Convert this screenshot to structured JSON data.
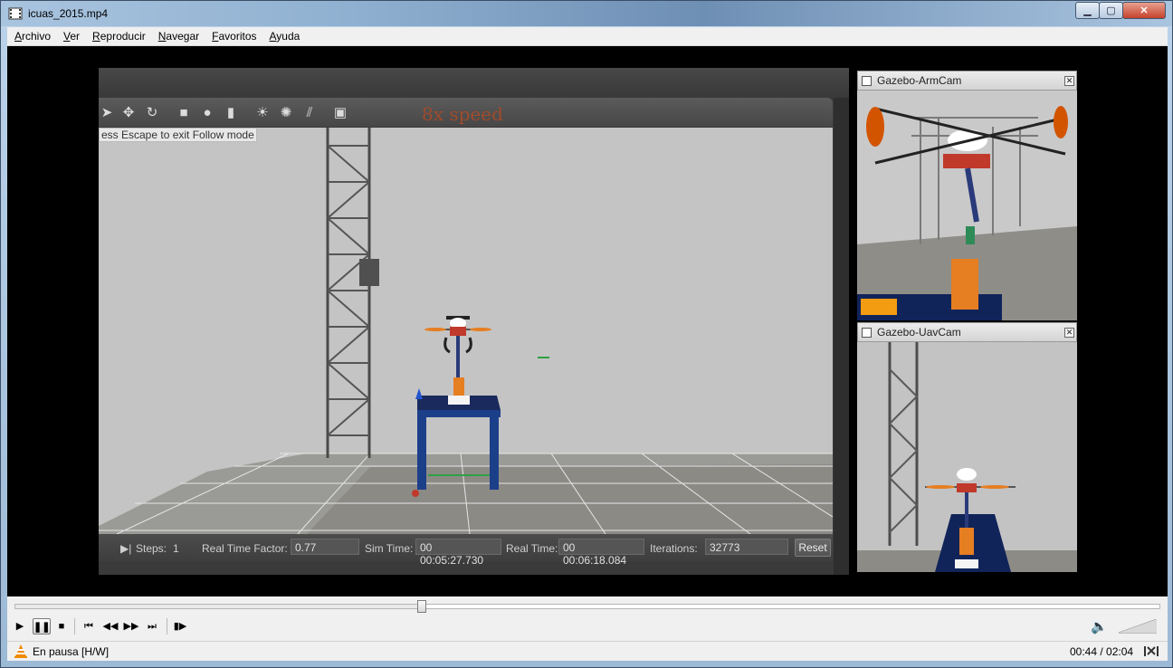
{
  "window": {
    "title": "icuas_2015.mp4",
    "controls": {
      "minimize": "▁",
      "maximize": "▢",
      "close": "✕"
    }
  },
  "menu": {
    "items": [
      {
        "u": "A",
        "rest": "rchivo"
      },
      {
        "u": "V",
        "rest": "er"
      },
      {
        "u": "R",
        "rest": "eproducir"
      },
      {
        "u": "N",
        "rest": "avegar"
      },
      {
        "u": "F",
        "rest": "avoritos"
      },
      {
        "u": "A",
        "rest": "yuda"
      }
    ]
  },
  "gazebo": {
    "overlay_text": "8x speed",
    "follow_hint": "ess Escape to exit Follow mode",
    "toolbar_icons": [
      "select-arrow-icon",
      "translate-icon",
      "rotate-icon",
      "box-icon",
      "sphere-icon",
      "cylinder-icon",
      "point-light-icon",
      "spot-light-icon",
      "directional-light-icon",
      "screenshot-icon"
    ],
    "status": {
      "steps_label": "Steps:",
      "steps_value": "1",
      "rtf_label": "Real Time Factor:",
      "rtf_value": "0.77",
      "sim_time_label": "Sim Time:",
      "sim_time_value": "00 00:05:27.730",
      "real_time_label": "Real Time:",
      "real_time_value": "00 00:06:18.084",
      "iterations_label": "Iterations:",
      "iterations_value": "32773",
      "reset_label": "Reset"
    }
  },
  "cams": {
    "arm": {
      "title": "Gazebo-ArmCam"
    },
    "uav": {
      "title": "Gazebo-UavCam"
    }
  },
  "player": {
    "progress": 0.355,
    "volume": 1.0,
    "status": "En pausa [H/W]",
    "time": "00:44 / 02:04",
    "buttons": {
      "play": "▶",
      "pause": "❚❚",
      "stop": "■",
      "prev": "⏮",
      "rewind": "◀◀",
      "forward": "▶▶",
      "next": "⏭",
      "frame": "▮▶"
    }
  },
  "colors": {
    "speed_text": "#a04b2c",
    "table_blue": "#1c3f8a",
    "accent_orange": "#e67e22"
  }
}
